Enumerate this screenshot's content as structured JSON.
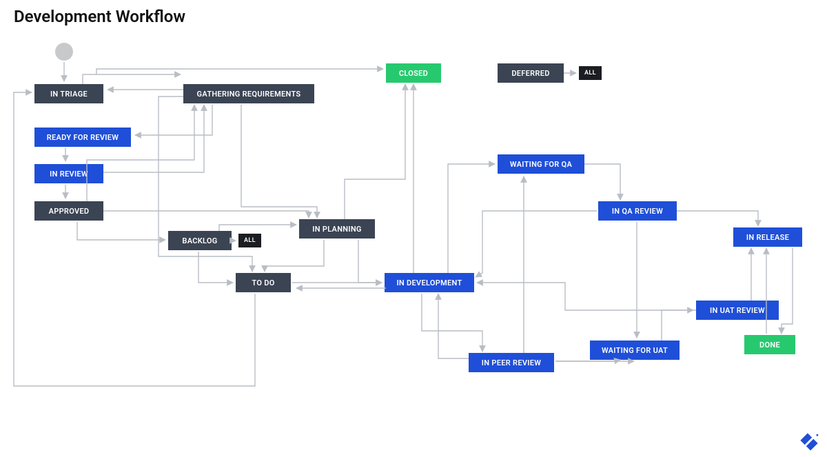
{
  "title": "Development Workflow",
  "nodes": {
    "in_triage": {
      "label": "IN TRIAGE",
      "kind": "dark"
    },
    "gathering_req": {
      "label": "GATHERING REQUIREMENTS",
      "kind": "dark"
    },
    "ready_for_review": {
      "label": "READY FOR REVIEW",
      "kind": "blue"
    },
    "in_review": {
      "label": "IN REVIEW",
      "kind": "blue"
    },
    "approved": {
      "label": "APPROVED",
      "kind": "dark"
    },
    "backlog": {
      "label": "BACKLOG",
      "kind": "dark"
    },
    "in_planning": {
      "label": "IN PLANNING",
      "kind": "dark"
    },
    "to_do": {
      "label": "TO DO",
      "kind": "dark"
    },
    "closed": {
      "label": "CLOSED",
      "kind": "green"
    },
    "deferred": {
      "label": "DEFERRED",
      "kind": "dark"
    },
    "in_development": {
      "label": "IN DEVELOPMENT",
      "kind": "blue"
    },
    "waiting_for_qa": {
      "label": "WAITING FOR QA",
      "kind": "blue"
    },
    "in_qa_review": {
      "label": "IN QA REVIEW",
      "kind": "blue"
    },
    "in_release": {
      "label": "IN RELEASE",
      "kind": "blue"
    },
    "in_uat_review": {
      "label": "IN UAT REVIEW",
      "kind": "blue"
    },
    "waiting_for_uat": {
      "label": "WAITING FOR UAT",
      "kind": "blue"
    },
    "in_peer_review": {
      "label": "IN PEER REVIEW",
      "kind": "blue"
    },
    "done": {
      "label": "DONE",
      "kind": "green"
    }
  },
  "tags": {
    "backlog_all": {
      "label": "ALL"
    },
    "deferred_all": {
      "label": "ALL"
    }
  },
  "edges": [
    {
      "from": "start",
      "to": "in_triage"
    },
    {
      "from": "in_triage",
      "to": "gathering_requirements"
    },
    {
      "from": "in_triage",
      "to": "closed"
    },
    {
      "from": "gathering_requirements",
      "to": "ready_for_review"
    },
    {
      "from": "gathering_requirements",
      "to": "in_planning"
    },
    {
      "from": "ready_for_review",
      "to": "in_review"
    },
    {
      "from": "in_review",
      "to": "gathering_requirements"
    },
    {
      "from": "in_review",
      "to": "approved"
    },
    {
      "from": "approved",
      "to": "backlog"
    },
    {
      "from": "approved",
      "to": "in_planning"
    },
    {
      "from": "approved",
      "to": "gathering_requirements"
    },
    {
      "from": "backlog",
      "to": "in_planning"
    },
    {
      "from": "backlog",
      "to": "to_do"
    },
    {
      "from": "backlog",
      "to": "all"
    },
    {
      "from": "in_planning",
      "to": "to_do"
    },
    {
      "from": "in_planning",
      "to": "closed"
    },
    {
      "from": "to_do",
      "to": "in_development"
    },
    {
      "from": "to_do",
      "to": "in_triage"
    },
    {
      "from": "in_development",
      "to": "in_peer_review"
    },
    {
      "from": "in_development",
      "to": "waiting_for_qa"
    },
    {
      "from": "in_development",
      "to": "closed"
    },
    {
      "from": "in_development",
      "to": "to_do"
    },
    {
      "from": "in_peer_review",
      "to": "in_development"
    },
    {
      "from": "in_peer_review",
      "to": "waiting_for_qa"
    },
    {
      "from": "in_peer_review",
      "to": "waiting_for_uat"
    },
    {
      "from": "waiting_for_qa",
      "to": "in_qa_review"
    },
    {
      "from": "in_qa_review",
      "to": "in_development"
    },
    {
      "from": "in_qa_review",
      "to": "waiting_for_uat"
    },
    {
      "from": "in_qa_review",
      "to": "in_release"
    },
    {
      "from": "waiting_for_uat",
      "to": "in_uat_review"
    },
    {
      "from": "in_uat_review",
      "to": "in_development"
    },
    {
      "from": "in_uat_review",
      "to": "in_release"
    },
    {
      "from": "in_release",
      "to": "done"
    },
    {
      "from": "deferred",
      "to": "all"
    }
  ],
  "colors": {
    "dark": "#3b4453",
    "blue": "#1f4fd8",
    "green": "#27c96f",
    "tag": "#1b1d22",
    "line": "#b9bdc4"
  }
}
